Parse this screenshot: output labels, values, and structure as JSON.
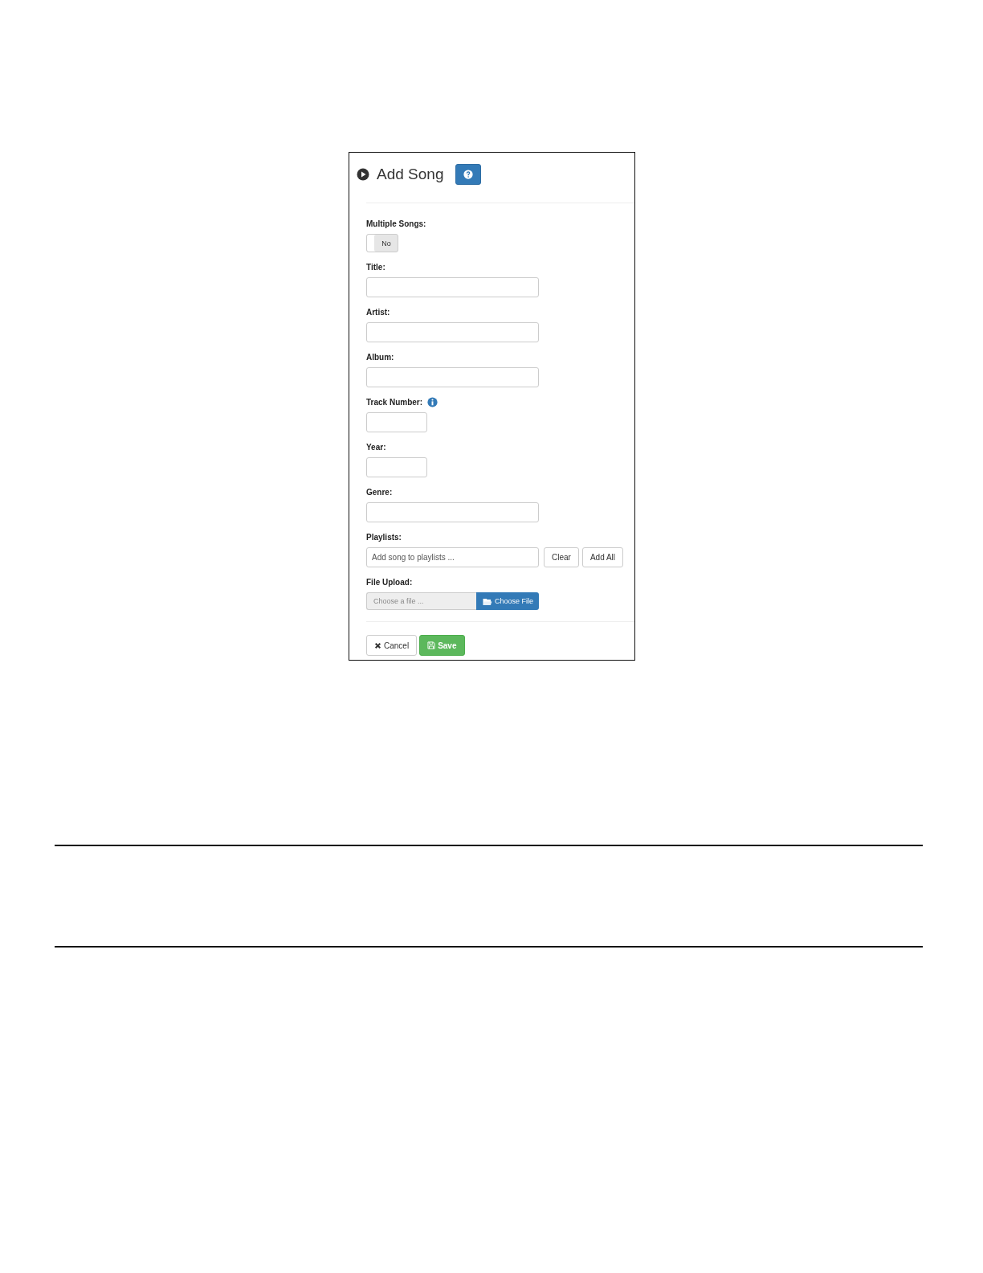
{
  "panel": {
    "title": "Add Song"
  },
  "fields": [
    {
      "kind": "toggle",
      "label": "Multiple Songs:",
      "on": false,
      "value": "No"
    },
    {
      "kind": "text",
      "label": "Title:"
    },
    {
      "kind": "text",
      "label": "Artist:"
    },
    {
      "kind": "text",
      "label": "Album:"
    },
    {
      "kind": "short",
      "label": "Track Number:",
      "info": true
    },
    {
      "kind": "short",
      "label": "Year:"
    },
    {
      "kind": "text",
      "label": "Genre:"
    },
    {
      "kind": "tags",
      "label": "Playlists:",
      "placeholder": "Add song to playlists ...",
      "buttons": [
        "Clear",
        "Add All"
      ]
    },
    {
      "kind": "file",
      "label": "File Upload:",
      "placeholder": "Choose a file ...",
      "button": "Choose File"
    }
  ],
  "actions": [
    {
      "kind": "cancel",
      "label": "Cancel"
    },
    {
      "kind": "save",
      "label": "Save"
    }
  ]
}
